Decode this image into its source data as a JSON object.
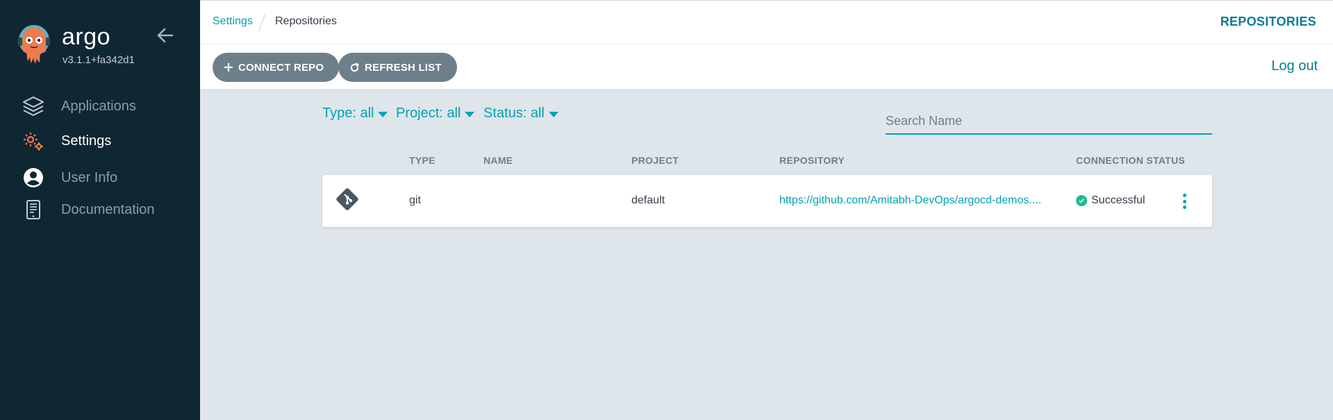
{
  "app": {
    "name": "argo",
    "version": "v3.1.1+fa342d1"
  },
  "sidebar": {
    "items": [
      {
        "label": "Applications",
        "icon": "layers-icon"
      },
      {
        "label": "Settings",
        "icon": "gear-icon",
        "active": true
      },
      {
        "label": "User Info",
        "icon": "user-circle-icon"
      },
      {
        "label": "Documentation",
        "icon": "book-icon"
      }
    ]
  },
  "breadcrumb": {
    "parent": "Settings",
    "current": "Repositories"
  },
  "header": {
    "title": "REPOSITORIES"
  },
  "toolbar": {
    "connect_label": "CONNECT REPO",
    "refresh_label": "REFRESH LIST",
    "logout_label": "Log out"
  },
  "filters": {
    "type": "Type: all",
    "project": "Project: all",
    "status": "Status: all"
  },
  "search": {
    "placeholder": "Search Name",
    "value": ""
  },
  "table": {
    "headers": [
      "TYPE",
      "NAME",
      "PROJECT",
      "REPOSITORY",
      "CONNECTION STATUS"
    ],
    "rows": [
      {
        "icon": "git-icon",
        "type": "git",
        "name": "",
        "project": "default",
        "repository": "https://github.com/Amitabh-DevOps/argocd-demos....",
        "status": "Successful"
      }
    ]
  },
  "colors": {
    "sidebar_bg": "#0f2733",
    "accent": "#00a2b3",
    "title_teal": "#0b7c94",
    "button_gray": "#6d7f8b",
    "success": "#18be94",
    "logo_orange": "#ef7b4d"
  }
}
